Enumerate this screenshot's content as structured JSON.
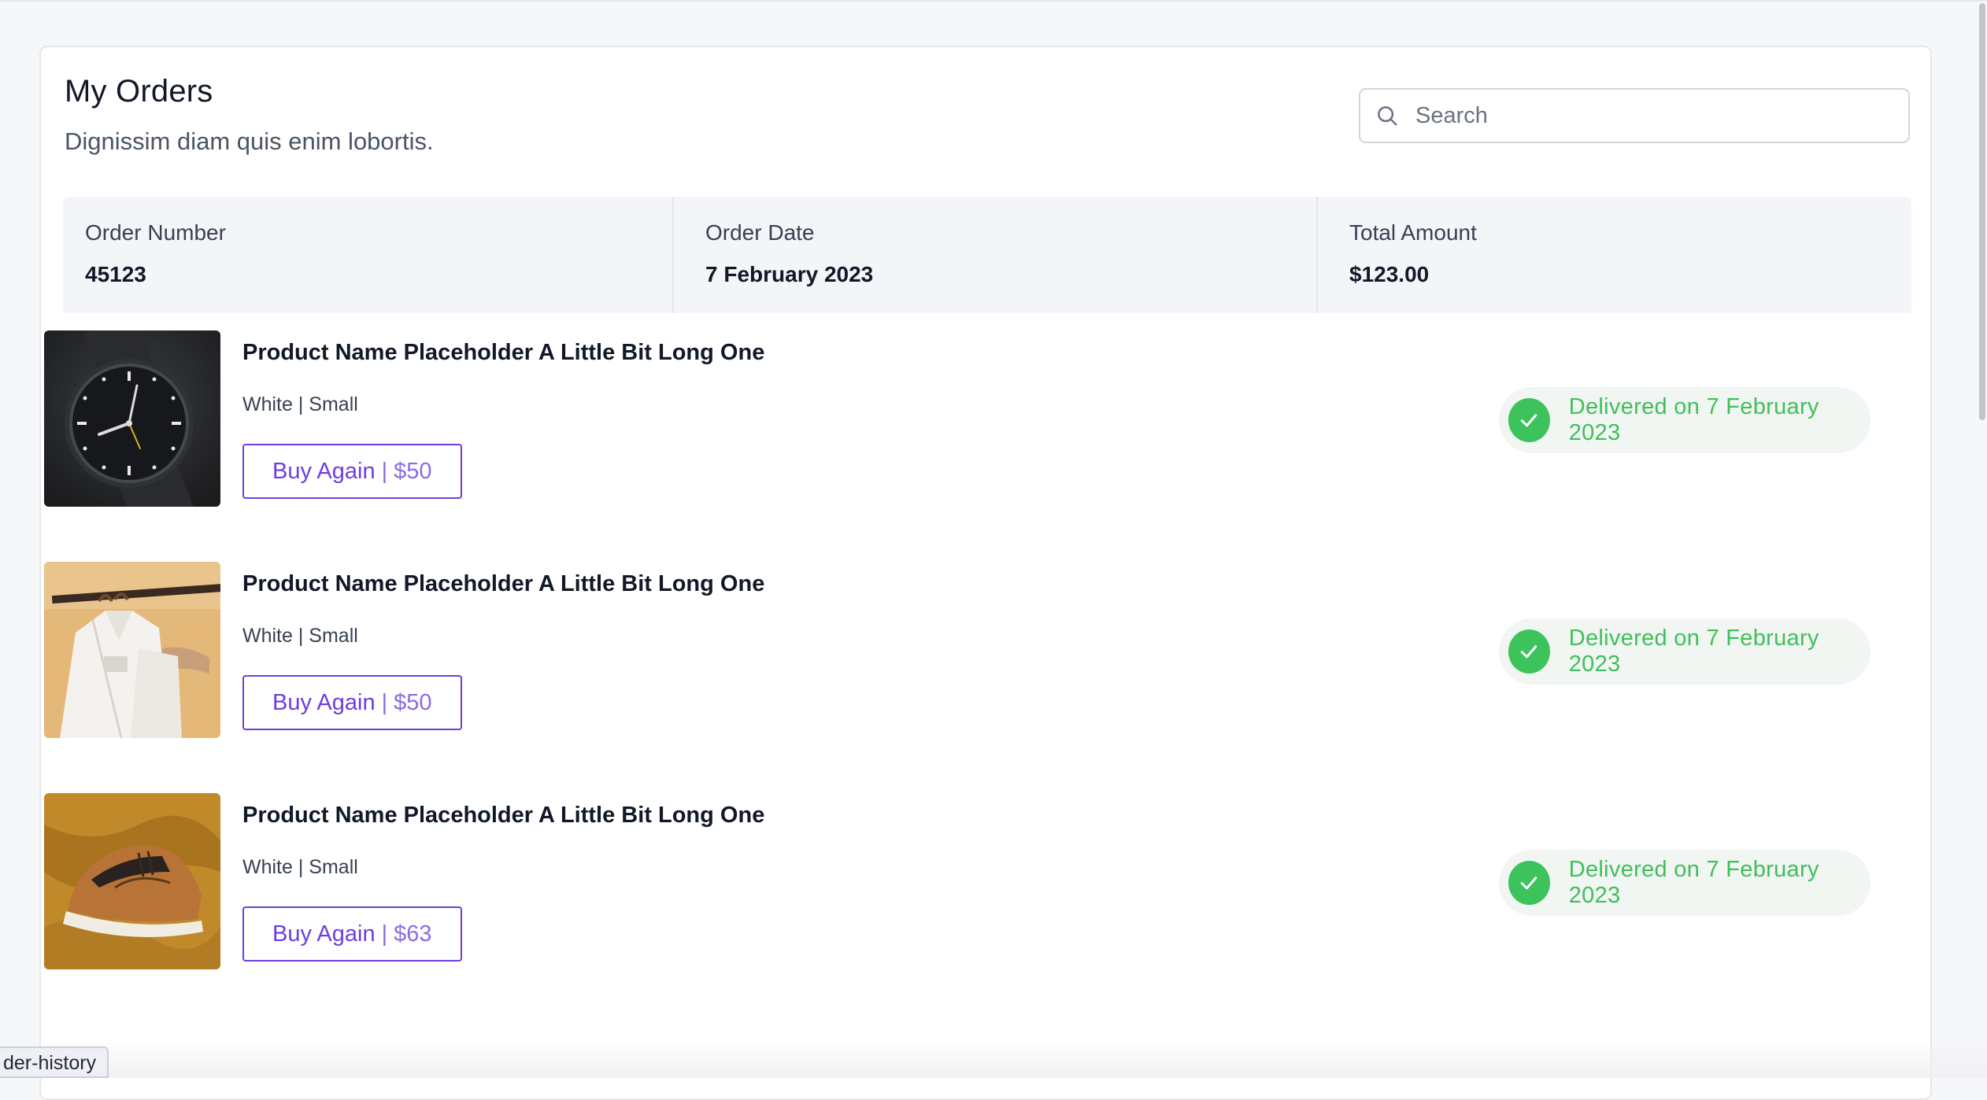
{
  "header": {
    "title": "My Orders",
    "subtitle": "Dignissim diam quis enim lobortis."
  },
  "search": {
    "placeholder": "Search",
    "icon": "search-icon"
  },
  "order_summary": {
    "number_label": "Order Number",
    "number_value": "45123",
    "date_label": "Order Date",
    "date_value": "7 February 2023",
    "total_label": "Total Amount",
    "total_value": "$123.00"
  },
  "items": [
    {
      "name": "Product Name Placeholder A Little Bit Long One",
      "variant": "White | Small",
      "buy_label": "Buy Again",
      "separator": "|",
      "price": "$50",
      "status": "Delivered on 7 February 2023",
      "image": "watch-photo"
    },
    {
      "name": "Product Name Placeholder A Little Bit Long One",
      "variant": "White | Small",
      "buy_label": "Buy Again",
      "separator": "|",
      "price": "$50",
      "status": "Delivered on 7 February 2023",
      "image": "shirt-photo"
    },
    {
      "name": "Product Name Placeholder A Little Bit Long One",
      "variant": "White | Small",
      "buy_label": "Buy Again",
      "separator": "|",
      "price": "$63",
      "status": "Delivered on 7 February 2023",
      "image": "sneaker-photo"
    }
  ],
  "status_bar": {
    "url_text": "der-history"
  },
  "colors": {
    "accent": "#6d3ee0",
    "success": "#3cc35b",
    "success_bg": "#f1f6f2",
    "summary_bg": "#f3f5f8"
  }
}
